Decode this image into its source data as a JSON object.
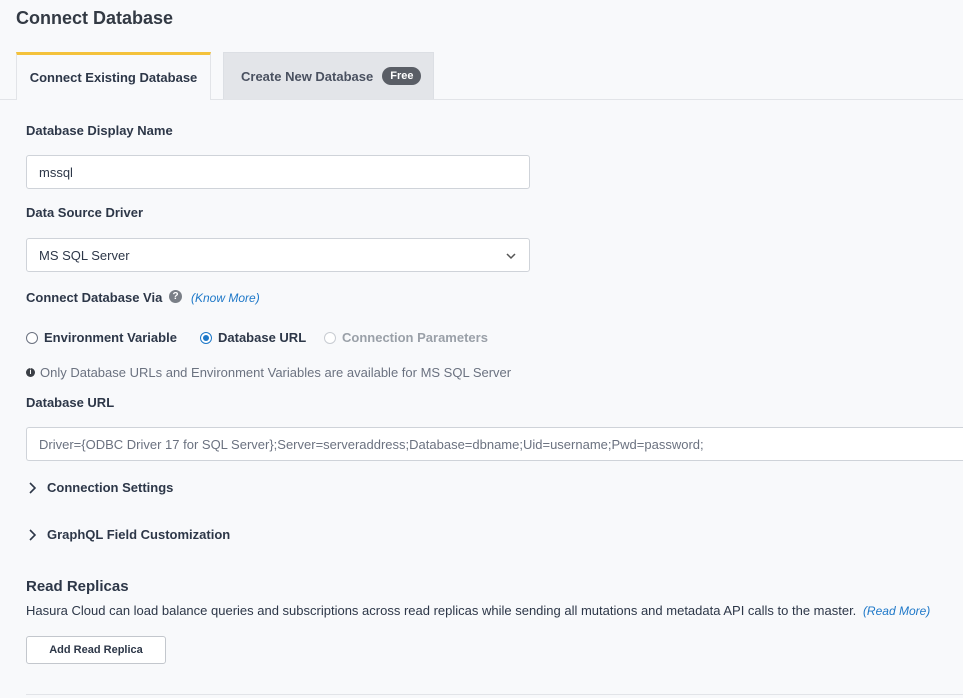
{
  "page_title": "Connect Database",
  "tabs": {
    "connect_existing": "Connect Existing Database",
    "create_new": "Create New Database",
    "create_new_badge": "Free"
  },
  "form": {
    "display_name_label": "Database Display Name",
    "display_name_value": "mssql",
    "driver_label": "Data Source Driver",
    "driver_value": "MS SQL Server",
    "connect_via_label": "Connect Database Via",
    "know_more_link": "(Know More)",
    "radio_options": [
      {
        "label": "Environment Variable",
        "checked": false,
        "disabled": false
      },
      {
        "label": "Database URL",
        "checked": true,
        "disabled": false
      },
      {
        "label": "Connection Parameters",
        "checked": false,
        "disabled": true
      }
    ],
    "info_text": "Only Database URLs and Environment Variables are available for MS SQL Server",
    "url_label": "Database URL",
    "url_placeholder": "Driver={ODBC Driver 17 for SQL Server};Server=serveraddress;Database=dbname;Uid=username;Pwd=password;",
    "connection_settings": "Connection Settings",
    "graphql_customization": "GraphQL Field Customization"
  },
  "read_replicas": {
    "heading": "Read Replicas",
    "description": "Hasura Cloud can load balance queries and subscriptions across read replicas while sending all mutations and metadata API calls to the master.",
    "read_more_link": "(Read More)",
    "add_button": "Add Read Replica"
  },
  "icons": {
    "help": "question-circle-icon",
    "info": "info-circle-icon",
    "dropdown": "chevron-down-icon",
    "expand": "chevron-right-icon"
  },
  "colors": {
    "tab_accent": "#f4c23b",
    "link": "#1e78c8",
    "badge_bg": "#5a5e66",
    "background": "#f8f9fb"
  }
}
